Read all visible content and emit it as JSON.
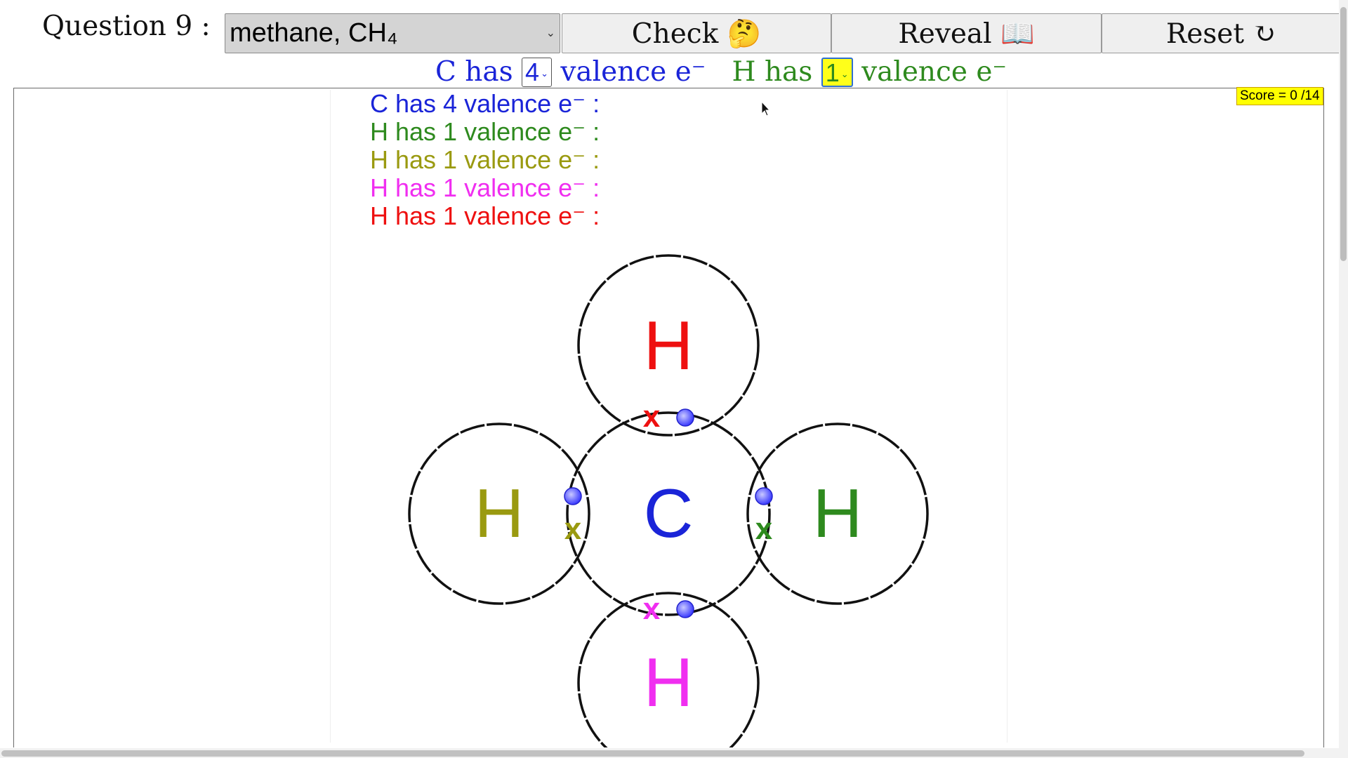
{
  "header": {
    "question_label": "Question 9 :",
    "molecule_select": "methane, CH₄",
    "check_label": "Check 🤔",
    "reveal_label": "Reveal 📖",
    "reset_label": "Reset ↻"
  },
  "valence_row": {
    "c_prefix": "C has",
    "c_value": "4",
    "c_suffix": "valence e⁻",
    "h_prefix": "H has",
    "h_value": "1",
    "h_suffix": "valence e⁻"
  },
  "score": "Score = 0 /14",
  "valence_lines": [
    {
      "text": "C has 4 valence e⁻ :",
      "color": "#1a24d8"
    },
    {
      "text": "H has 1 valence e⁻ :",
      "color": "#2e8a1e"
    },
    {
      "text": "H has 1 valence e⁻ :",
      "color": "#9a9a10"
    },
    {
      "text": "H has 1 valence e⁻ :",
      "color": "#f02ef0"
    },
    {
      "text": "H has 1 valence e⁻ :",
      "color": "#ee1010"
    }
  ],
  "atoms": {
    "center": {
      "symbol": "C",
      "color": "#1a24d8"
    },
    "top": {
      "symbol": "H",
      "color": "#ee1010"
    },
    "left": {
      "symbol": "H",
      "color": "#9a9a10"
    },
    "right": {
      "symbol": "H",
      "color": "#2e8a1e"
    },
    "bottom": {
      "symbol": "H",
      "color": "#f02ef0"
    }
  },
  "electron_cross": "x",
  "colors": {
    "carbon_electron": "#3b3bff",
    "score_bg": "#ffff00",
    "highlight_select": "#ffff1a"
  }
}
